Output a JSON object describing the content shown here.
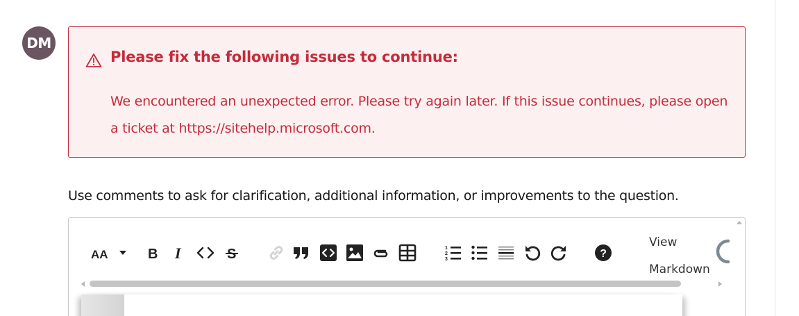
{
  "avatar": {
    "initials": "DM"
  },
  "alert": {
    "icon": "warning-triangle-icon",
    "title": "Please fix the following issues to continue:",
    "message": "We encountered an unexpected error. Please try again later. If this issue continues, please open a ticket at https://sitehelp.microsoft.com.",
    "color": "#c42b3c",
    "background": "#fdf0f0"
  },
  "comment_hint": "Use comments to ask for clarification, additional information, or improvements to the question.",
  "editor": {
    "toolbar": [
      {
        "name": "text-size-icon",
        "label": "AA"
      },
      {
        "name": "chevron-down-icon"
      },
      {
        "name": "bold-icon",
        "label": "B"
      },
      {
        "name": "italic-icon",
        "label": "I"
      },
      {
        "name": "inline-code-icon"
      },
      {
        "name": "strikethrough-icon",
        "label": "S"
      },
      {
        "name": "link-icon",
        "disabled": true
      },
      {
        "name": "quote-icon"
      },
      {
        "name": "code-block-icon"
      },
      {
        "name": "image-icon"
      },
      {
        "name": "attachment-icon"
      },
      {
        "name": "table-icon"
      },
      {
        "name": "ordered-list-icon"
      },
      {
        "name": "unordered-list-icon"
      },
      {
        "name": "horizontal-rule-icon"
      },
      {
        "name": "undo-icon"
      },
      {
        "name": "redo-icon"
      },
      {
        "name": "help-icon"
      }
    ],
    "view_markdown_line1": "View",
    "view_markdown_line2": "Markdown"
  }
}
